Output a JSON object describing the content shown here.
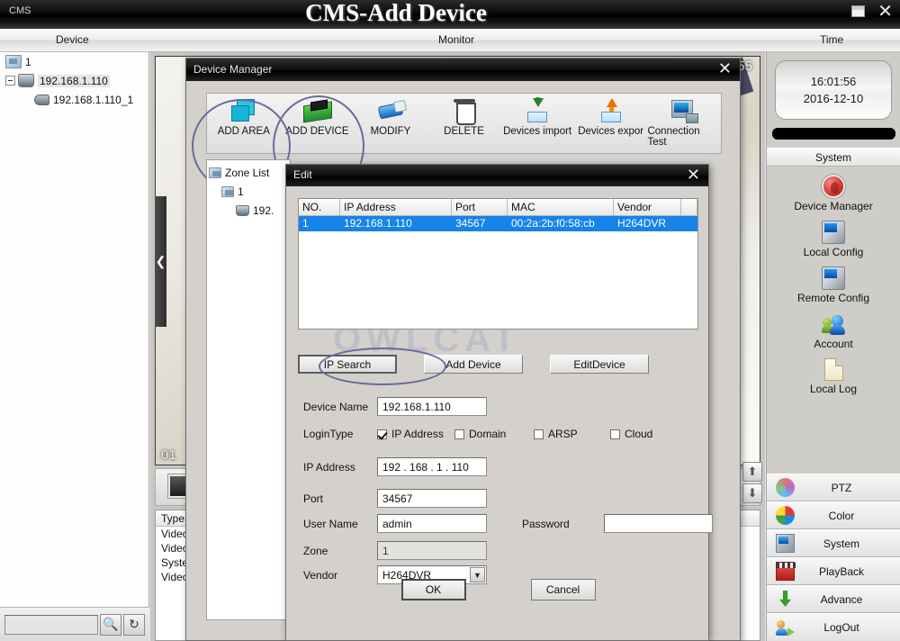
{
  "titlebar": {
    "app_name": "CMS",
    "title": "CMS-Add Device",
    "restore_icon": "restore-icon",
    "close_icon": "close-icon"
  },
  "menubar": {
    "items": [
      {
        "label": "Device"
      },
      {
        "label": "Monitor"
      },
      {
        "label": "Time"
      }
    ]
  },
  "device_tree": {
    "nodes": [
      {
        "label": "1",
        "icon": "area-icon"
      },
      {
        "label": "192.168.1.110",
        "icon": "device-icon"
      },
      {
        "label": "192.168.1.110_1",
        "icon": "camera-icon"
      }
    ],
    "search_value": "",
    "search_icon": "search-icon",
    "refresh_icon": "refresh-icon"
  },
  "video_area": {
    "timestamp_overlay": ":55",
    "channel_overlay": "01",
    "collapse_icon": "chevron-left-icon",
    "scroll_up_icon": "arrow-up-icon",
    "scroll_down_icon": "arrow-down-icon",
    "log_header": "Type",
    "log_rows": [
      "Video",
      "Video",
      "Syste",
      "Video"
    ]
  },
  "right_panel": {
    "clock": {
      "time": "16:01:56",
      "date": "2016-12-10"
    },
    "section_title": "System",
    "system_items": [
      {
        "label": "Device Manager",
        "icon": "device-manager-icon"
      },
      {
        "label": "Local Config",
        "icon": "local-config-icon"
      },
      {
        "label": "Remote Config",
        "icon": "remote-config-icon"
      },
      {
        "label": "Account",
        "icon": "account-icon"
      },
      {
        "label": "Local Log",
        "icon": "local-log-icon"
      }
    ],
    "menu_items": [
      {
        "label": "PTZ",
        "icon": "ptz-icon"
      },
      {
        "label": "Color",
        "icon": "color-icon"
      },
      {
        "label": "System",
        "icon": "system-icon"
      },
      {
        "label": "PlayBack",
        "icon": "playback-icon"
      },
      {
        "label": "Advance",
        "icon": "advance-icon"
      },
      {
        "label": "LogOut",
        "icon": "logout-icon"
      }
    ]
  },
  "device_manager": {
    "title": "Device Manager",
    "close_icon": "close-icon",
    "toolbar": [
      {
        "label": "ADD AREA",
        "icon": "add-area-icon",
        "highlighted": true
      },
      {
        "label": "ADD DEVICE",
        "icon": "add-device-icon",
        "highlighted": true
      },
      {
        "label": "MODIFY",
        "icon": "modify-icon",
        "highlighted": false
      },
      {
        "label": "DELETE",
        "icon": "delete-icon",
        "highlighted": false
      },
      {
        "label": "Devices import",
        "icon": "devices-import-icon",
        "highlighted": false
      },
      {
        "label": "Devices expor",
        "icon": "devices-export-icon",
        "highlighted": false
      },
      {
        "label": "Connection Test",
        "icon": "connection-test-icon",
        "highlighted": false
      }
    ],
    "zone_tree": [
      {
        "label": "Zone List"
      },
      {
        "label": "1"
      },
      {
        "label": "192."
      }
    ]
  },
  "edit_dialog": {
    "title": "Edit",
    "close_icon": "close-icon",
    "watermark": "OWLCAT",
    "table": {
      "columns": [
        "NO.",
        "IP Address",
        "Port",
        "MAC",
        "Vendor",
        ""
      ],
      "rows": [
        {
          "no": "1",
          "ip": "192.168.1.110",
          "port": "34567",
          "mac": "00:2a:2b:f0:58:cb",
          "vendor": "H264DVR",
          "extra": ""
        }
      ]
    },
    "buttons": {
      "ip_search": "IP Search",
      "add_device": "Add Device",
      "edit_device": "EditDevice",
      "ok": "OK",
      "cancel": "Cancel"
    },
    "form": {
      "device_name_label": "Device Name",
      "device_name_value": "192.168.1.110",
      "login_type_label": "LoginType",
      "login_types": [
        {
          "label": "IP Address",
          "checked": true
        },
        {
          "label": "Domain",
          "checked": false
        },
        {
          "label": "ARSP",
          "checked": false
        },
        {
          "label": "Cloud",
          "checked": false
        }
      ],
      "ip_address_label": "IP Address",
      "ip_address_value": "192 . 168 .  1  . 110",
      "port_label": "Port",
      "port_value": "34567",
      "user_name_label": "User Name",
      "user_name_value": "admin",
      "password_label": "Password",
      "password_value": "",
      "zone_label": "Zone",
      "zone_value": "1",
      "vendor_label": "Vendor",
      "vendor_value": "H264DVR",
      "vendor_arrow_icon": "chevron-down-icon"
    }
  }
}
